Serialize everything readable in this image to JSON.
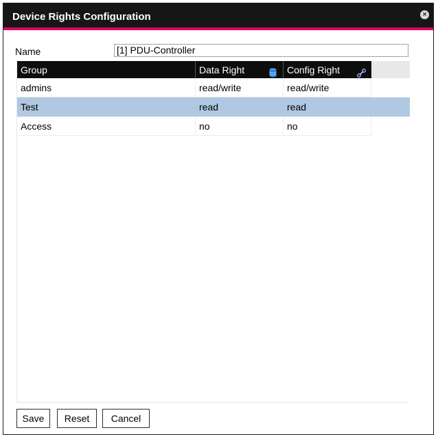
{
  "dialog": {
    "title": "Device Rights Configuration",
    "close_glyph": "×"
  },
  "form": {
    "name_label": "Name",
    "name_value": "[1] PDU-Controller"
  },
  "grid": {
    "columns": [
      {
        "label": "Group",
        "icon": null
      },
      {
        "label": "Data Right",
        "icon": "database-icon"
      },
      {
        "label": "Config Right",
        "icon": "link-icon"
      }
    ],
    "rows": [
      {
        "group": "admins",
        "data_right": "read/write",
        "config_right": "read/write",
        "selected": false
      },
      {
        "group": "Test",
        "data_right": "read",
        "config_right": "read",
        "selected": true
      },
      {
        "group": "Access",
        "data_right": "no",
        "config_right": "no",
        "selected": false
      }
    ]
  },
  "buttons": {
    "save": "Save",
    "reset": "Reset",
    "cancel": "Cancel"
  },
  "colors": {
    "title_bg": "#161616",
    "accent": "#e0005f",
    "header_bg": "#0d0d0d",
    "selection": "#b0c8e2"
  }
}
